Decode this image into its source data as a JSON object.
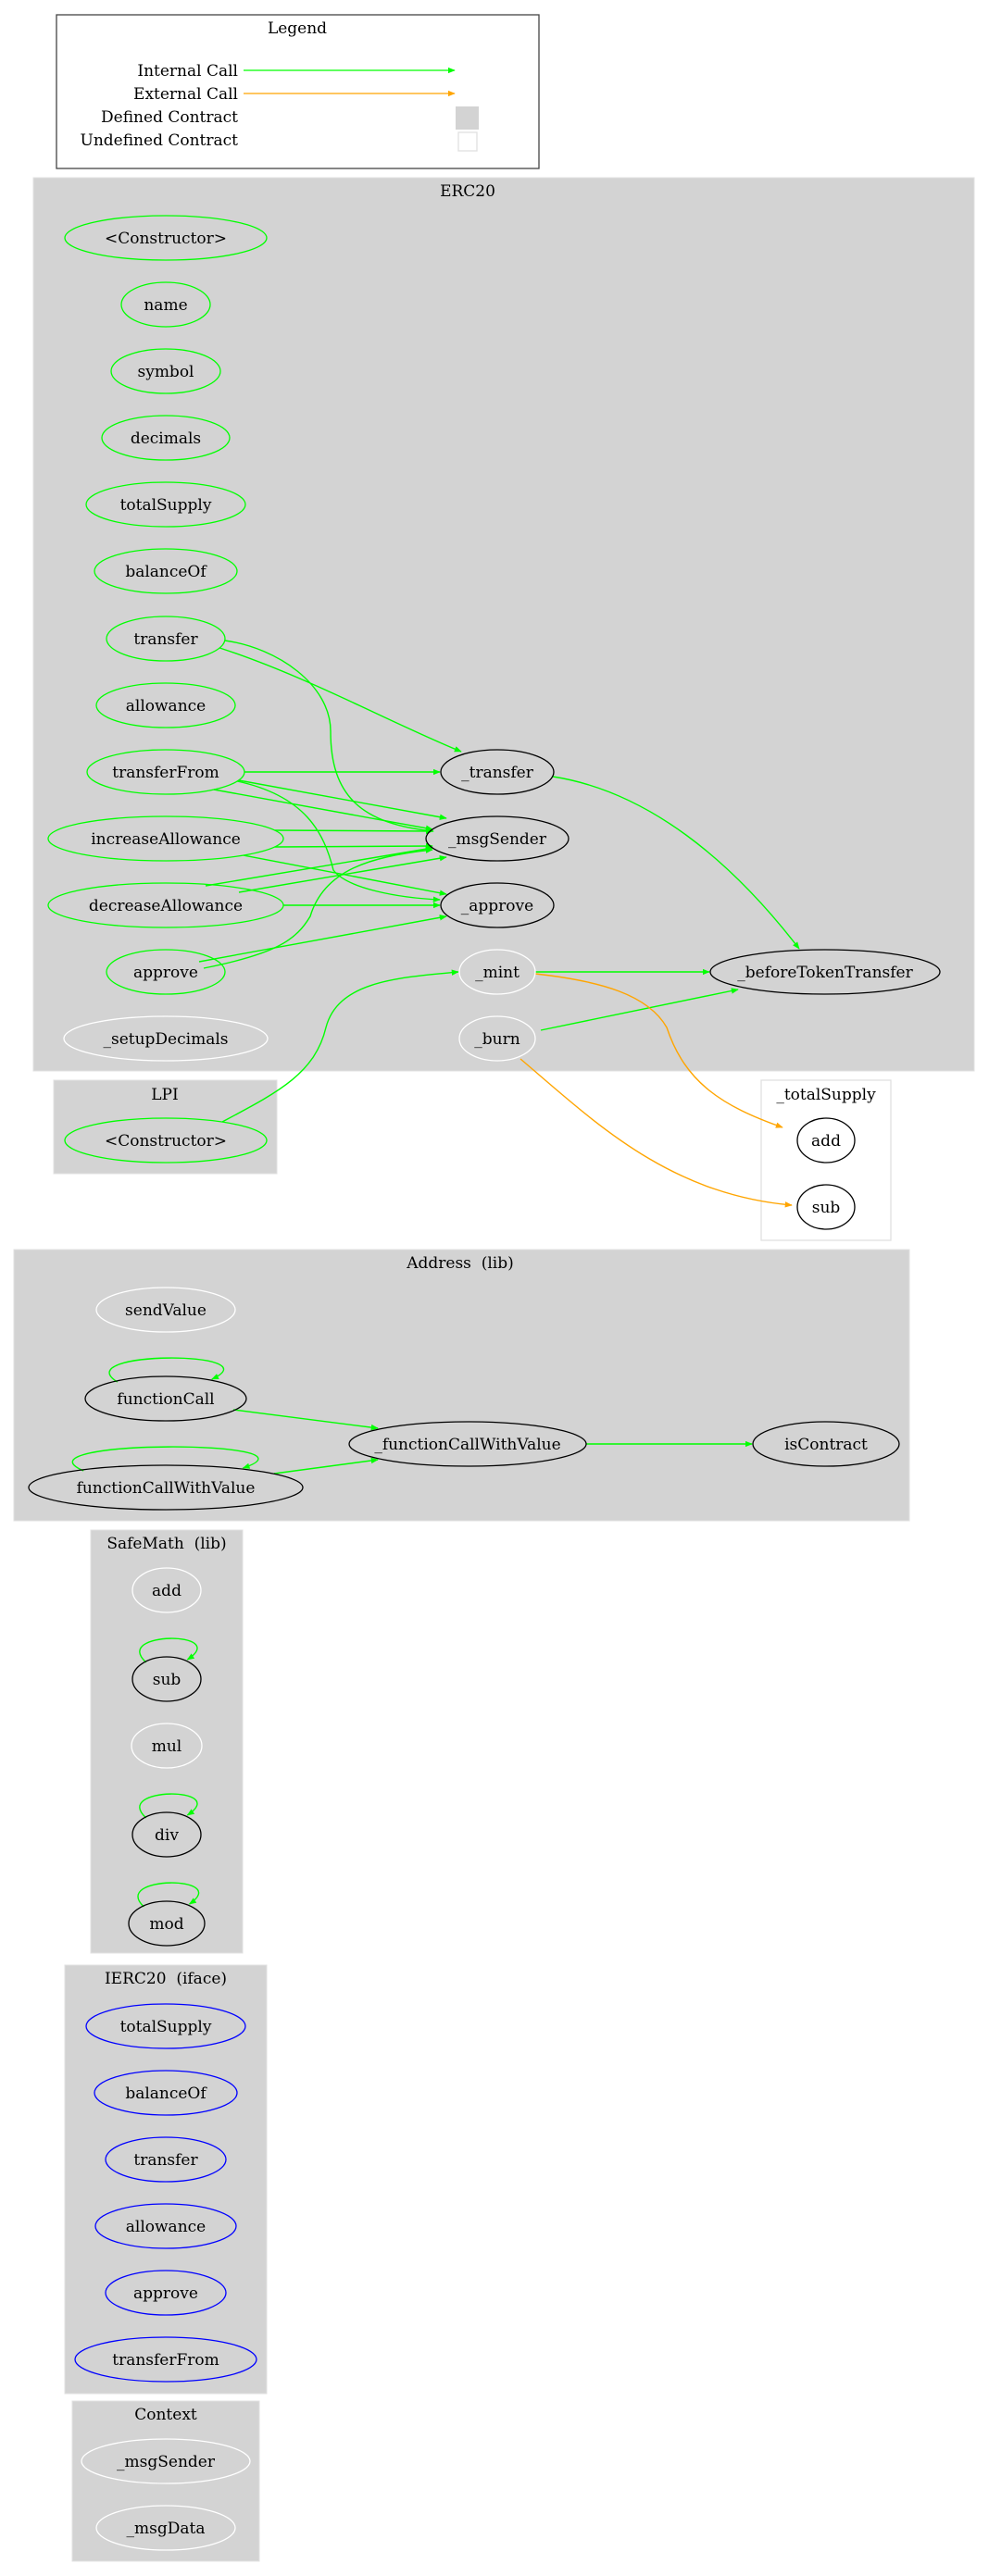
{
  "legend": {
    "title": "Legend",
    "items": [
      {
        "label": "Internal Call",
        "kind": "internal"
      },
      {
        "label": "External Call",
        "kind": "external"
      },
      {
        "label": "Defined Contract",
        "kind": "defined"
      },
      {
        "label": "Undefined Contract",
        "kind": "undefined"
      }
    ]
  },
  "colors": {
    "internal_call": "#00ff00",
    "external_call": "#ffa500",
    "defined_contract_fill": "#d3d3d3",
    "undefined_contract_border": "#e0e0e0",
    "public_function_border": "#00ff00",
    "internal_function_border": "#000000",
    "unused_function_border": "#ffffff",
    "interface_function_border": "#0000ff"
  },
  "clusters": [
    {
      "id": "erc20",
      "title": "ERC20",
      "kind": "defined",
      "nodes": [
        {
          "id": "erc20_ctor",
          "label": "<Constructor>",
          "style": "public"
        },
        {
          "id": "erc20_name",
          "label": "name",
          "style": "public"
        },
        {
          "id": "erc20_symbol",
          "label": "symbol",
          "style": "public"
        },
        {
          "id": "erc20_decimals",
          "label": "decimals",
          "style": "public"
        },
        {
          "id": "erc20_totalSupply",
          "label": "totalSupply",
          "style": "public"
        },
        {
          "id": "erc20_balanceOf",
          "label": "balanceOf",
          "style": "public"
        },
        {
          "id": "erc20_transfer",
          "label": "transfer",
          "style": "public"
        },
        {
          "id": "erc20_allowance",
          "label": "allowance",
          "style": "public"
        },
        {
          "id": "erc20_transferFrom",
          "label": "transferFrom",
          "style": "public"
        },
        {
          "id": "erc20_increaseAllowance",
          "label": "increaseAllowance",
          "style": "public"
        },
        {
          "id": "erc20_decreaseAllowance",
          "label": "decreaseAllowance",
          "style": "public"
        },
        {
          "id": "erc20_approve",
          "label": "approve",
          "style": "public"
        },
        {
          "id": "erc20_setupDecimals",
          "label": "_setupDecimals",
          "style": "unused"
        },
        {
          "id": "erc20__transfer",
          "label": "_transfer",
          "style": "internal"
        },
        {
          "id": "erc20__msgSender",
          "label": "_msgSender",
          "style": "internal"
        },
        {
          "id": "erc20__approve",
          "label": "_approve",
          "style": "internal"
        },
        {
          "id": "erc20__mint",
          "label": "_mint",
          "style": "unused"
        },
        {
          "id": "erc20__burn",
          "label": "_burn",
          "style": "unused"
        },
        {
          "id": "erc20__beforeTokenTransfer",
          "label": "_beforeTokenTransfer",
          "style": "internal"
        }
      ]
    },
    {
      "id": "lpi",
      "title": "LPI",
      "kind": "defined",
      "nodes": [
        {
          "id": "lpi_ctor",
          "label": "<Constructor>",
          "style": "public"
        }
      ]
    },
    {
      "id": "totalSupply",
      "title": "_totalSupply",
      "kind": "undefined",
      "nodes": [
        {
          "id": "ts_add",
          "label": "add",
          "style": "internal"
        },
        {
          "id": "ts_sub",
          "label": "sub",
          "style": "internal"
        }
      ]
    },
    {
      "id": "address",
      "title": "Address  (lib)",
      "kind": "defined",
      "nodes": [
        {
          "id": "addr_sendValue",
          "label": "sendValue",
          "style": "unused"
        },
        {
          "id": "addr_functionCall",
          "label": "functionCall",
          "style": "internal"
        },
        {
          "id": "addr_functionCallWithValue",
          "label": "functionCallWithValue",
          "style": "internal"
        },
        {
          "id": "addr__functionCallWithValue",
          "label": "_functionCallWithValue",
          "style": "internal"
        },
        {
          "id": "addr_isContract",
          "label": "isContract",
          "style": "internal"
        }
      ]
    },
    {
      "id": "safemath",
      "title": "SafeMath  (lib)",
      "kind": "defined",
      "nodes": [
        {
          "id": "sm_add",
          "label": "add",
          "style": "unused"
        },
        {
          "id": "sm_sub",
          "label": "sub",
          "style": "internal"
        },
        {
          "id": "sm_mul",
          "label": "mul",
          "style": "unused"
        },
        {
          "id": "sm_div",
          "label": "div",
          "style": "internal"
        },
        {
          "id": "sm_mod",
          "label": "mod",
          "style": "internal"
        }
      ]
    },
    {
      "id": "ierc20",
      "title": "IERC20  (iface)",
      "kind": "defined",
      "nodes": [
        {
          "id": "i_totalSupply",
          "label": "totalSupply",
          "style": "interface"
        },
        {
          "id": "i_balanceOf",
          "label": "balanceOf",
          "style": "interface"
        },
        {
          "id": "i_transfer",
          "label": "transfer",
          "style": "interface"
        },
        {
          "id": "i_allowance",
          "label": "allowance",
          "style": "interface"
        },
        {
          "id": "i_approve",
          "label": "approve",
          "style": "interface"
        },
        {
          "id": "i_transferFrom",
          "label": "transferFrom",
          "style": "interface"
        }
      ]
    },
    {
      "id": "context",
      "title": "Context",
      "kind": "defined",
      "nodes": [
        {
          "id": "ctx_msgSender",
          "label": "_msgSender",
          "style": "unused"
        },
        {
          "id": "ctx_msgData",
          "label": "_msgData",
          "style": "unused"
        }
      ]
    }
  ],
  "edges": [
    {
      "from": "erc20_transfer",
      "to": "erc20__transfer",
      "type": "internal"
    },
    {
      "from": "erc20_transfer",
      "to": "erc20__msgSender",
      "type": "internal"
    },
    {
      "from": "erc20_transferFrom",
      "to": "erc20__transfer",
      "type": "internal"
    },
    {
      "from": "erc20_transferFrom",
      "to": "erc20__msgSender",
      "type": "internal"
    },
    {
      "from": "erc20_transferFrom",
      "to": "erc20__msgSender",
      "type": "internal",
      "variant": 2
    },
    {
      "from": "erc20_transferFrom",
      "to": "erc20__approve",
      "type": "internal"
    },
    {
      "from": "erc20_increaseAllowance",
      "to": "erc20__msgSender",
      "type": "internal"
    },
    {
      "from": "erc20_increaseAllowance",
      "to": "erc20__msgSender",
      "type": "internal",
      "variant": 2
    },
    {
      "from": "erc20_increaseAllowance",
      "to": "erc20__approve",
      "type": "internal"
    },
    {
      "from": "erc20_decreaseAllowance",
      "to": "erc20__msgSender",
      "type": "internal"
    },
    {
      "from": "erc20_decreaseAllowance",
      "to": "erc20__msgSender",
      "type": "internal",
      "variant": 2
    },
    {
      "from": "erc20_decreaseAllowance",
      "to": "erc20__approve",
      "type": "internal"
    },
    {
      "from": "erc20_approve",
      "to": "erc20__msgSender",
      "type": "internal"
    },
    {
      "from": "erc20_approve",
      "to": "erc20__approve",
      "type": "internal"
    },
    {
      "from": "erc20__transfer",
      "to": "erc20__beforeTokenTransfer",
      "type": "internal"
    },
    {
      "from": "erc20__mint",
      "to": "erc20__beforeTokenTransfer",
      "type": "internal"
    },
    {
      "from": "erc20__burn",
      "to": "erc20__beforeTokenTransfer",
      "type": "internal"
    },
    {
      "from": "erc20__mint",
      "to": "ts_add",
      "type": "external"
    },
    {
      "from": "erc20__burn",
      "to": "ts_sub",
      "type": "external"
    },
    {
      "from": "lpi_ctor",
      "to": "erc20__mint",
      "type": "internal"
    },
    {
      "from": "addr_functionCall",
      "to": "addr_functionCall",
      "type": "internal"
    },
    {
      "from": "addr_functionCall",
      "to": "addr__functionCallWithValue",
      "type": "internal"
    },
    {
      "from": "addr_functionCallWithValue",
      "to": "addr_functionCallWithValue",
      "type": "internal"
    },
    {
      "from": "addr_functionCallWithValue",
      "to": "addr__functionCallWithValue",
      "type": "internal"
    },
    {
      "from": "addr__functionCallWithValue",
      "to": "addr_isContract",
      "type": "internal"
    },
    {
      "from": "sm_sub",
      "to": "sm_sub",
      "type": "internal"
    },
    {
      "from": "sm_div",
      "to": "sm_div",
      "type": "internal"
    },
    {
      "from": "sm_mod",
      "to": "sm_mod",
      "type": "internal"
    }
  ]
}
